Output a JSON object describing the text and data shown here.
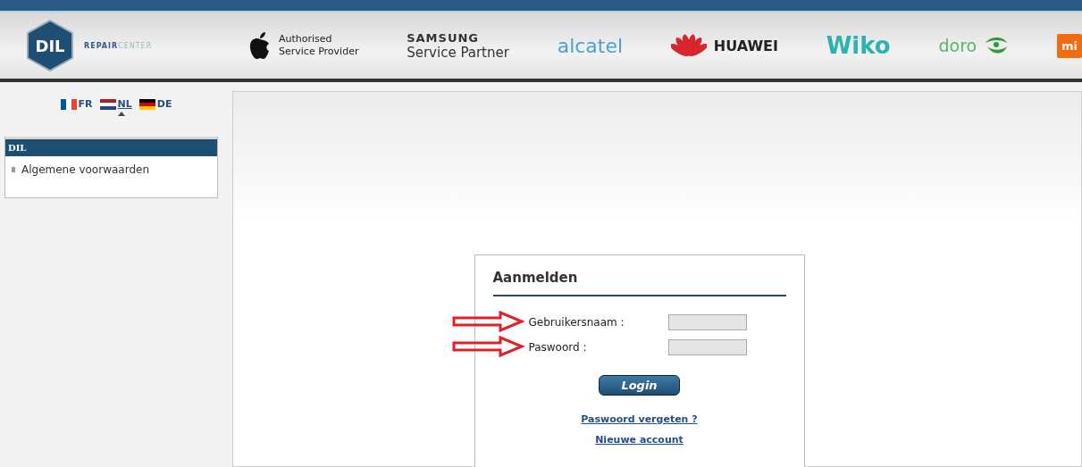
{
  "header": {
    "logo": {
      "mark": "DIL",
      "wordmark_bold": "REPAIR",
      "wordmark_light": "CENTER"
    },
    "partners": [
      {
        "kind": "apple",
        "lines": [
          "Authorised",
          "Service Provider"
        ]
      },
      {
        "kind": "samsung",
        "lines": [
          "SAMSUNG",
          "Service Partner"
        ]
      },
      {
        "kind": "alcatel",
        "lines": [
          "alcatel"
        ]
      },
      {
        "kind": "huawei",
        "lines": [
          "HUAWEI"
        ]
      },
      {
        "kind": "wiko",
        "lines": [
          "Wiko"
        ]
      },
      {
        "kind": "doro",
        "lines": [
          "doro"
        ]
      },
      {
        "kind": "mi",
        "lines": [
          "mi"
        ]
      }
    ]
  },
  "languages": [
    {
      "code": "FR",
      "selected": false
    },
    {
      "code": "NL",
      "selected": true
    },
    {
      "code": "DE",
      "selected": false
    }
  ],
  "sidebar": {
    "title": "DIL",
    "items": [
      "Algemene voorwaarden"
    ]
  },
  "login": {
    "title": "Aanmelden",
    "fields": [
      "Gebruikersnaam :",
      "Paswoord :"
    ],
    "button": "Login",
    "links": [
      "Paswoord vergeten ?",
      "Nieuwe account"
    ]
  }
}
